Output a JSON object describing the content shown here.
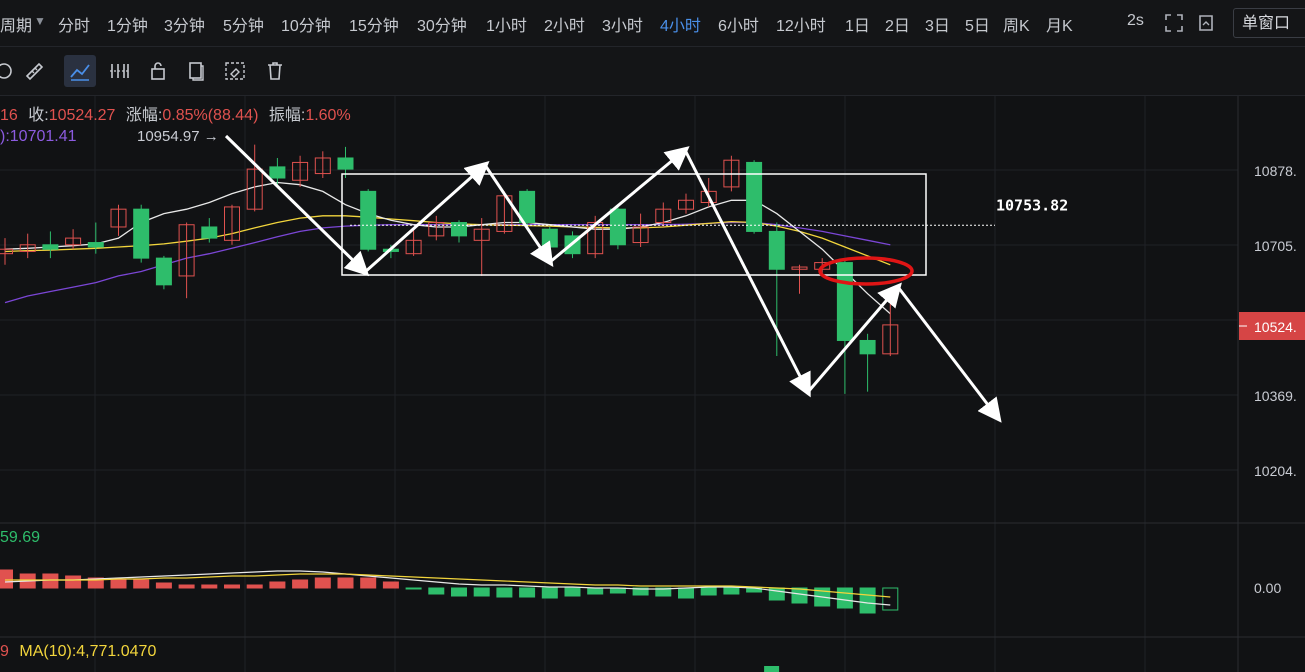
{
  "topbar": {
    "period_label": "周期",
    "intervals": [
      "分时",
      "1分钟",
      "3分钟",
      "5分钟",
      "10分钟",
      "15分钟",
      "30分钟",
      "1小时",
      "2小时",
      "3小时",
      "4小时",
      "6小时",
      "12小时",
      "1日",
      "2日",
      "3日",
      "5日",
      "周K",
      "月K"
    ],
    "active_interval": "4小时",
    "refresh": "2s",
    "window_mode": "单窗口"
  },
  "toolbar": {
    "icons": [
      "target-icon",
      "ruler-icon",
      "trend-line-icon",
      "bars-icon",
      "lock-icon",
      "copy-icon",
      "grid-eraser-icon",
      "trash-icon"
    ]
  },
  "info_line": {
    "open_tail": "16",
    "close_label": "收:",
    "close_value": "10524.27",
    "change_label": "涨幅:",
    "change_value": "0.85%(88.44)",
    "amp_label": "振幅:",
    "amp_value": "1.60%"
  },
  "ma_line": {
    "text": "):10701.41"
  },
  "macd_line": {
    "text": "59.69"
  },
  "vol_line": {
    "prefix": "9",
    "text": "MA(10):4,771.0470"
  },
  "colors": {
    "up": "#e0524f",
    "down": "#2ebd6b",
    "ma_white": "#e8e8e8",
    "ma_yellow": "#f2d53c",
    "ma_purple": "#7b46d6",
    "box": "#ffffff",
    "circle": "#e01515",
    "price_tag_bg": "#d64545"
  },
  "chart_data": {
    "type": "candlestick",
    "y_axis_ticks": [
      "10878.",
      "10705.",
      "10524.",
      "10369.",
      "10204.",
      "0.00"
    ],
    "ylim": [
      10130,
      11000
    ],
    "high_annotation": "10954.97",
    "current_price_tag": "10524.",
    "level_label": "10753.82",
    "level_value": 10753.82,
    "candles": [
      {
        "o": 10690,
        "c": 10700,
        "h": 10725,
        "l": 10665
      },
      {
        "o": 10695,
        "c": 10710,
        "h": 10735,
        "l": 10680
      },
      {
        "o": 10710,
        "c": 10700,
        "h": 10740,
        "l": 10680
      },
      {
        "o": 10710,
        "c": 10725,
        "h": 10745,
        "l": 10700
      },
      {
        "o": 10715,
        "c": 10705,
        "h": 10760,
        "l": 10690
      },
      {
        "o": 10750,
        "c": 10790,
        "h": 10800,
        "l": 10730
      },
      {
        "o": 10790,
        "c": 10680,
        "h": 10800,
        "l": 10670
      },
      {
        "o": 10680,
        "c": 10620,
        "h": 10685,
        "l": 10610
      },
      {
        "o": 10640,
        "c": 10755,
        "h": 10760,
        "l": 10590
      },
      {
        "o": 10750,
        "c": 10725,
        "h": 10770,
        "l": 10715
      },
      {
        "o": 10720,
        "c": 10795,
        "h": 10800,
        "l": 10710
      },
      {
        "o": 10790,
        "c": 10880,
        "h": 10935,
        "l": 10785
      },
      {
        "o": 10885,
        "c": 10860,
        "h": 10905,
        "l": 10840
      },
      {
        "o": 10855,
        "c": 10895,
        "h": 10910,
        "l": 10840
      },
      {
        "o": 10870,
        "c": 10905,
        "h": 10920,
        "l": 10860
      },
      {
        "o": 10905,
        "c": 10880,
        "h": 10930,
        "l": 10860
      },
      {
        "o": 10830,
        "c": 10700,
        "h": 10835,
        "l": 10695
      },
      {
        "o": 10700,
        "c": 10695,
        "h": 10710,
        "l": 10680
      },
      {
        "o": 10690,
        "c": 10720,
        "h": 10745,
        "l": 10685
      },
      {
        "o": 10730,
        "c": 10760,
        "h": 10775,
        "l": 10720
      },
      {
        "o": 10760,
        "c": 10730,
        "h": 10765,
        "l": 10715
      },
      {
        "o": 10720,
        "c": 10745,
        "h": 10770,
        "l": 10640
      },
      {
        "o": 10740,
        "c": 10820,
        "h": 10830,
        "l": 10735
      },
      {
        "o": 10830,
        "c": 10760,
        "h": 10835,
        "l": 10745
      },
      {
        "o": 10745,
        "c": 10705,
        "h": 10750,
        "l": 10690
      },
      {
        "o": 10730,
        "c": 10690,
        "h": 10740,
        "l": 10680
      },
      {
        "o": 10690,
        "c": 10760,
        "h": 10775,
        "l": 10680
      },
      {
        "o": 10790,
        "c": 10710,
        "h": 10795,
        "l": 10700
      },
      {
        "o": 10715,
        "c": 10750,
        "h": 10780,
        "l": 10705
      },
      {
        "o": 10760,
        "c": 10790,
        "h": 10805,
        "l": 10750
      },
      {
        "o": 10790,
        "c": 10810,
        "h": 10825,
        "l": 10780
      },
      {
        "o": 10805,
        "c": 10830,
        "h": 10860,
        "l": 10795
      },
      {
        "o": 10840,
        "c": 10900,
        "h": 10910,
        "l": 10830
      },
      {
        "o": 10895,
        "c": 10740,
        "h": 10900,
        "l": 10735
      },
      {
        "o": 10740,
        "c": 10655,
        "h": 10760,
        "l": 10460
      },
      {
        "o": 10655,
        "c": 10660,
        "h": 10665,
        "l": 10600
      },
      {
        "o": 10655,
        "c": 10670,
        "h": 10680,
        "l": 10640
      },
      {
        "o": 10670,
        "c": 10495,
        "h": 10680,
        "l": 10375
      },
      {
        "o": 10495,
        "c": 10465,
        "h": 10510,
        "l": 10380
      },
      {
        "o": 10465,
        "c": 10530,
        "h": 10590,
        "l": 10460
      }
    ],
    "ma_white": [
      10700,
      10702,
      10705,
      10708,
      10712,
      10725,
      10760,
      10780,
      10790,
      10805,
      10825,
      10840,
      10850,
      10845,
      10830,
      10800,
      10780,
      10765,
      10755,
      10750,
      10750,
      10755,
      10760,
      10760,
      10755,
      10750,
      10745,
      10745,
      10750,
      10760,
      10775,
      10795,
      10810,
      10810,
      10780,
      10740,
      10700,
      10650,
      10600,
      10555
    ],
    "ma_yellow": [
      10695,
      10697,
      10698,
      10700,
      10702,
      10705,
      10708,
      10712,
      10718,
      10725,
      10735,
      10748,
      10760,
      10770,
      10775,
      10775,
      10772,
      10768,
      10764,
      10760,
      10757,
      10755,
      10754,
      10753,
      10752,
      10750,
      10749,
      10748,
      10748,
      10750,
      10754,
      10758,
      10762,
      10760,
      10752,
      10740,
      10725,
      10705,
      10685,
      10665
    ],
    "ma_purple": [
      10580,
      10595,
      10605,
      10615,
      10625,
      10640,
      10650,
      10665,
      10680,
      10690,
      10702,
      10715,
      10728,
      10740,
      10748,
      10752,
      10754,
      10755,
      10755,
      10755,
      10755,
      10755,
      10755,
      10755,
      10755,
      10755,
      10755,
      10755,
      10755,
      10755,
      10756,
      10758,
      10760,
      10760,
      10755,
      10748,
      10740,
      10730,
      10720,
      10710
    ],
    "macd_hist": [
      18,
      14,
      14,
      12,
      10,
      8,
      8,
      5,
      3,
      3,
      3,
      3,
      6,
      8,
      10,
      10,
      10,
      6,
      -1,
      -6,
      -8,
      -8,
      -9,
      -9,
      -10,
      -8,
      -6,
      -5,
      -7,
      -8,
      -10,
      -7,
      -6,
      -4,
      -12,
      -15,
      -18,
      -20,
      -25,
      -22
    ],
    "macd_dif": [
      6,
      7,
      8,
      8,
      9,
      10,
      11,
      12,
      13,
      14,
      15,
      16,
      17,
      17,
      16,
      14,
      12,
      10,
      8,
      6,
      4,
      3,
      3,
      2,
      1,
      1,
      0,
      0,
      -1,
      -1,
      0,
      1,
      1,
      0,
      -3,
      -6,
      -9,
      -12,
      -15,
      -17
    ],
    "macd_dea": [
      8,
      8,
      8,
      8,
      8,
      9,
      9,
      10,
      10,
      11,
      12,
      12,
      13,
      14,
      14,
      14,
      13,
      12,
      11,
      10,
      9,
      8,
      7,
      6,
      5,
      4,
      3,
      3,
      2,
      2,
      2,
      2,
      2,
      1,
      0,
      -1,
      -3,
      -5,
      -7,
      -9
    ],
    "volume_visible_bar_index": 33
  }
}
